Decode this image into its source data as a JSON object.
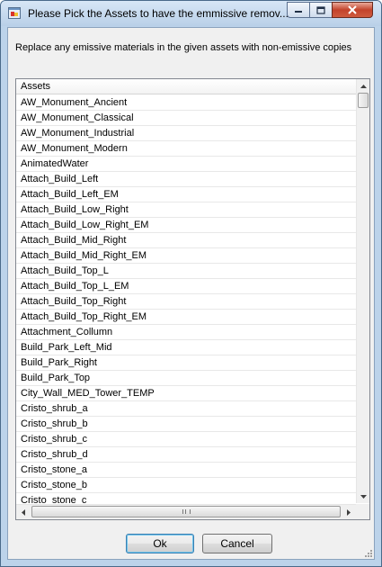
{
  "window": {
    "title": "Please Pick the Assets to have the emmissive remov...",
    "controls": {
      "minimize_icon": "minimize-icon",
      "maximize_icon": "maximize-icon",
      "close_icon": "close-icon"
    }
  },
  "description": "Replace any emissive materials in the given assets with non-emissive copies",
  "list": {
    "column_header": "Assets",
    "items": [
      "AW_Monument_Ancient",
      "AW_Monument_Classical",
      "AW_Monument_Industrial",
      "AW_Monument_Modern",
      "AnimatedWater",
      "Attach_Build_Left",
      "Attach_Build_Left_EM",
      "Attach_Build_Low_Right",
      "Attach_Build_Low_Right_EM",
      "Attach_Build_Mid_Right",
      "Attach_Build_Mid_Right_EM",
      "Attach_Build_Top_L",
      "Attach_Build_Top_L_EM",
      "Attach_Build_Top_Right",
      "Attach_Build_Top_Right_EM",
      "Attachment_Collumn",
      "Build_Park_Left_Mid",
      "Build_Park_Right",
      "Build_Park_Top",
      "City_Wall_MED_Tower_TEMP",
      "Cristo_shrub_a",
      "Cristo_shrub_b",
      "Cristo_shrub_c",
      "Cristo_shrub_d",
      "Cristo_stone_a",
      "Cristo_stone_b",
      "Cristo_stone_c"
    ]
  },
  "buttons": {
    "ok": "Ok",
    "cancel": "Cancel"
  },
  "colors": {
    "accent": "#3c7fb1",
    "close_button": "#c3432b",
    "frame": "#bcd3ea"
  }
}
